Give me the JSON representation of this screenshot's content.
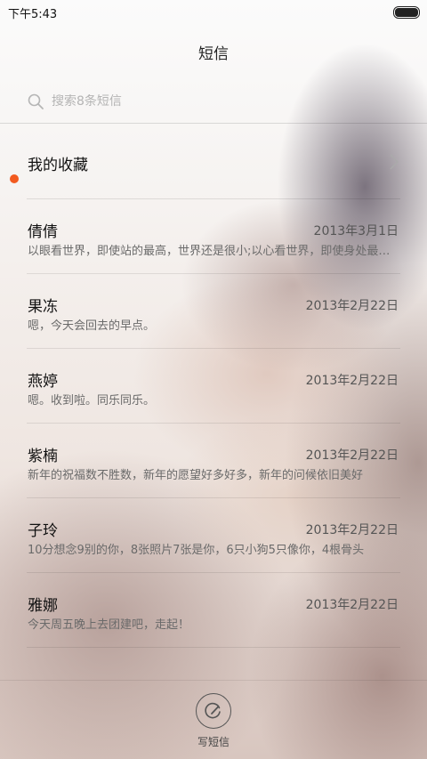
{
  "status": {
    "time": "下午5:43"
  },
  "header": {
    "title": "短信"
  },
  "search": {
    "placeholder": "搜索8条短信"
  },
  "favorites": {
    "label": "我的收藏"
  },
  "conversations": [
    {
      "name": "倩倩",
      "date": "2013年3月1日",
      "preview": "以眼看世界，即使站的最高，世界还是很小;以心看世界，即使身处最底层，世界也是很大",
      "unread": false
    },
    {
      "name": "果冻",
      "date": "2013年2月22日",
      "preview": "嗯，今天会回去的早点。",
      "unread": false
    },
    {
      "name": "燕婷",
      "date": "2013年2月22日",
      "preview": "嗯。收到啦。同乐同乐。",
      "unread": true
    },
    {
      "name": "紫楠",
      "date": "2013年2月22日",
      "preview": "新年的祝福数不胜数，新年的愿望好多好多，新年的问候依旧美好",
      "unread": false
    },
    {
      "name": "子玲",
      "date": "2013年2月22日",
      "preview": "10分想念9别的你，8张照片7张是你，6只小狗5只像你，4根骨头",
      "unread": false
    },
    {
      "name": "雅娜",
      "date": "2013年2月22日",
      "preview": "今天周五晚上去团建吧，走起！",
      "unread": false
    }
  ],
  "bottom": {
    "compose_label": "写短信"
  },
  "colors": {
    "unread_dot": "#f25a1f"
  },
  "icons": {
    "search": "search-icon",
    "chevron": "chevron-right-icon",
    "battery": "battery-icon",
    "compose": "compose-icon"
  }
}
